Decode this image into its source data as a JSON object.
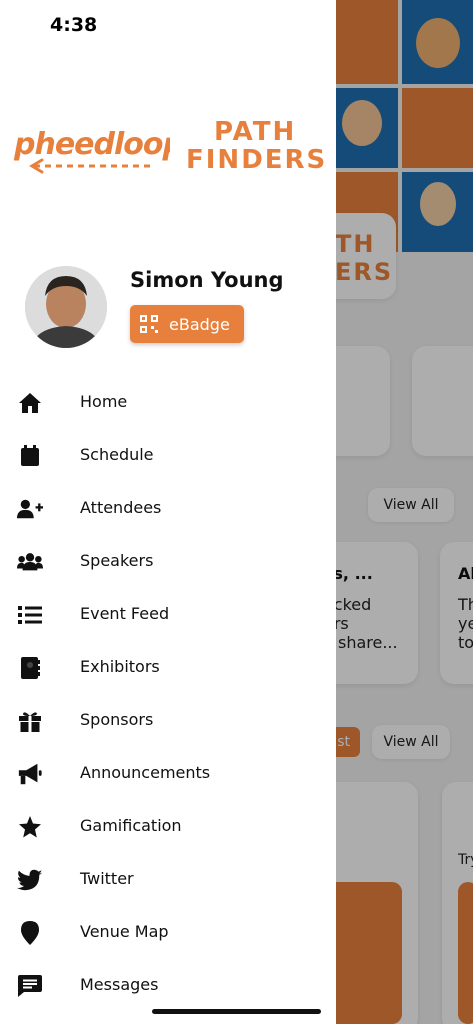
{
  "status_bar": {
    "time": "4:38"
  },
  "brand": {
    "pheedloop_logo_text": "pheedloop",
    "path_finders_line1": "PATH",
    "path_finders_line2": "FINDERS"
  },
  "user": {
    "name": "Simon Young",
    "ebadge_label": "eBadge"
  },
  "menu": {
    "items": [
      {
        "label": "Home",
        "icon": "home-icon"
      },
      {
        "label": "Schedule",
        "icon": "calendar-icon"
      },
      {
        "label": "Attendees",
        "icon": "user-plus-icon"
      },
      {
        "label": "Speakers",
        "icon": "users-icon"
      },
      {
        "label": "Event Feed",
        "icon": "list-icon"
      },
      {
        "label": "Exhibitors",
        "icon": "address-book-icon"
      },
      {
        "label": "Sponsors",
        "icon": "gift-icon"
      },
      {
        "label": "Announcements",
        "icon": "megaphone-icon"
      },
      {
        "label": "Gamification",
        "icon": "star-icon"
      },
      {
        "label": "Twitter",
        "icon": "twitter-icon"
      },
      {
        "label": "Venue Map",
        "icon": "map-pin-icon"
      },
      {
        "label": "Messages",
        "icon": "message-icon"
      }
    ]
  },
  "background": {
    "logo_line1": "TH",
    "logo_line2": "ERS",
    "view_all_1": "View All",
    "view_all_2": "View All",
    "card1_title": "ns, ...",
    "card1_line1": "acked",
    "card1_line2": "ers",
    "card1_line3": "ll share...",
    "card2_title": "Al",
    "card2_line1": "Th",
    "card2_line2": "ye",
    "card2_line3": "to",
    "orange_btn_label": "st",
    "card3_text": "Try"
  },
  "colors": {
    "accent": "#e7803c",
    "drawer_bg": "#ffffff",
    "text": "#111111"
  }
}
